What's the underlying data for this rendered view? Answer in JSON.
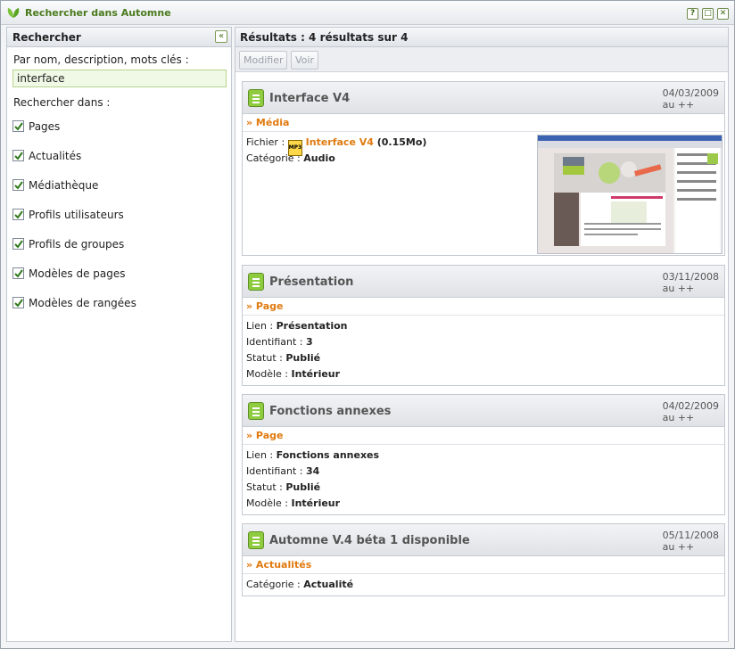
{
  "window": {
    "title": "Rechercher dans Automne",
    "buttons": {
      "help": "?",
      "maximize": "□",
      "close": "✕"
    }
  },
  "left": {
    "header": "Rechercher",
    "collapse_symbol": "«",
    "search_label": "Par nom, description, mots clés :",
    "search_value": "interface",
    "in_label": "Rechercher dans :",
    "checkboxes": [
      {
        "label": "Pages",
        "checked": true
      },
      {
        "label": "Actualités",
        "checked": true
      },
      {
        "label": "Médiathèque",
        "checked": true
      },
      {
        "label": "Profils utilisateurs",
        "checked": true
      },
      {
        "label": "Profils de groupes",
        "checked": true
      },
      {
        "label": "Modèles de pages",
        "checked": true
      },
      {
        "label": "Modèles de rangées",
        "checked": true
      }
    ]
  },
  "right": {
    "header": "Résultats : 4 résultats sur 4",
    "toolbar": {
      "modify": "Modifier",
      "view": "Voir"
    },
    "results": [
      {
        "title": "Interface V4",
        "date": "04/03/2009",
        "date_sub": "au ++",
        "type": "» Média",
        "file_label": "Fichier : ",
        "file_icon": "mp3-file-icon",
        "file_icon_text": "MP3",
        "file_name": "Interface V4",
        "file_size": " (0.15Mo)",
        "category_label": "Catégorie : ",
        "category_value": "Audio"
      },
      {
        "title": "Présentation",
        "date": "03/11/2008",
        "date_sub": "au ++",
        "type": "» Page",
        "rows": [
          {
            "label": "Lien : ",
            "value": "Présentation"
          },
          {
            "label": "Identifiant : ",
            "value": "3"
          },
          {
            "label": "Statut : ",
            "value": "Publié"
          },
          {
            "label": "Modèle : ",
            "value": "Intérieur"
          }
        ]
      },
      {
        "title": "Fonctions annexes",
        "date": "04/02/2009",
        "date_sub": "au ++",
        "type": "» Page",
        "rows": [
          {
            "label": "Lien : ",
            "value": "Fonctions annexes"
          },
          {
            "label": "Identifiant : ",
            "value": "34"
          },
          {
            "label": "Statut : ",
            "value": "Publié"
          },
          {
            "label": "Modèle : ",
            "value": "Intérieur"
          }
        ]
      },
      {
        "title": "Automne V.4 béta 1 disponible",
        "date": "05/11/2008",
        "date_sub": "au ++",
        "type": "» Actualités",
        "rows": [
          {
            "label": "Catégorie : ",
            "value": "Actualité"
          }
        ]
      }
    ]
  },
  "colors": {
    "accent": "#e07a0f",
    "brand_green": "#8fcb3f",
    "title_green": "#4b7a1d"
  }
}
